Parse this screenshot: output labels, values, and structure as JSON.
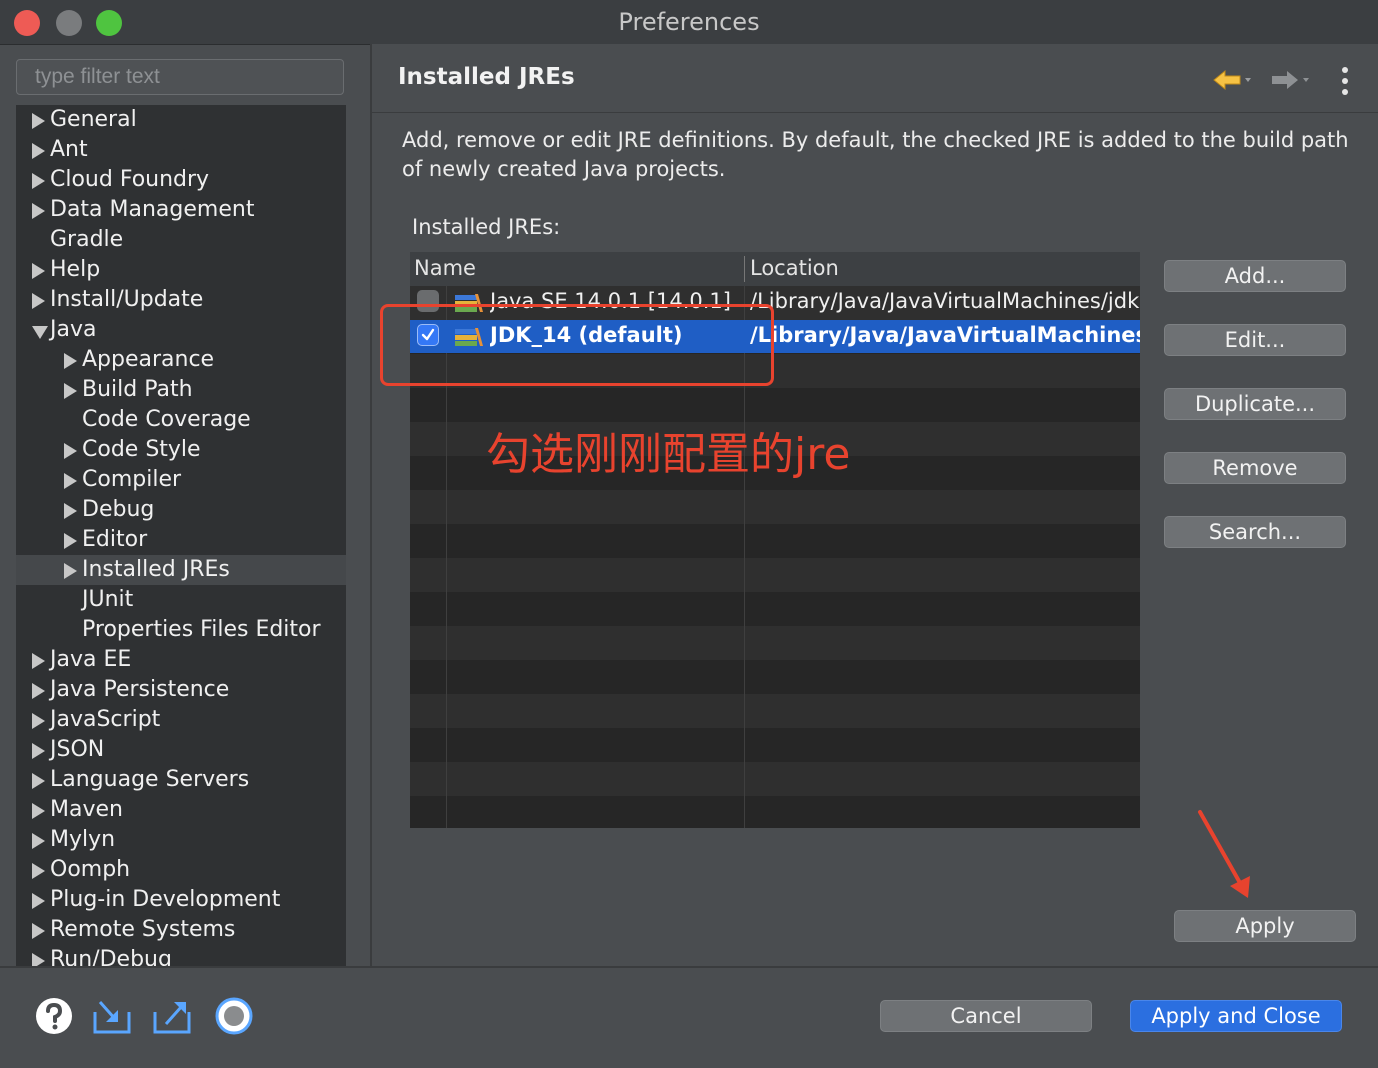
{
  "window": {
    "title": "Preferences"
  },
  "sidebar": {
    "filter_placeholder": "type filter text",
    "items": [
      {
        "label": "General",
        "expanded": false
      },
      {
        "label": "Ant",
        "expanded": false
      },
      {
        "label": "Cloud Foundry",
        "expanded": false
      },
      {
        "label": "Data Management",
        "expanded": false
      },
      {
        "label": "Gradle",
        "expanded": null
      },
      {
        "label": "Help",
        "expanded": false
      },
      {
        "label": "Install/Update",
        "expanded": false
      },
      {
        "label": "Java",
        "expanded": true
      },
      {
        "label": "Appearance",
        "expanded": false,
        "child": true
      },
      {
        "label": "Build Path",
        "expanded": false,
        "child": true
      },
      {
        "label": "Code Coverage",
        "expanded": null,
        "child": true
      },
      {
        "label": "Code Style",
        "expanded": false,
        "child": true
      },
      {
        "label": "Compiler",
        "expanded": false,
        "child": true
      },
      {
        "label": "Debug",
        "expanded": false,
        "child": true
      },
      {
        "label": "Editor",
        "expanded": false,
        "child": true
      },
      {
        "label": "Installed JREs",
        "expanded": false,
        "child": true,
        "selected": true
      },
      {
        "label": "JUnit",
        "expanded": null,
        "child": true
      },
      {
        "label": "Properties Files Editor",
        "expanded": null,
        "child": true
      },
      {
        "label": "Java EE",
        "expanded": false
      },
      {
        "label": "Java Persistence",
        "expanded": false
      },
      {
        "label": "JavaScript",
        "expanded": false
      },
      {
        "label": "JSON",
        "expanded": false
      },
      {
        "label": "Language Servers",
        "expanded": false
      },
      {
        "label": "Maven",
        "expanded": false
      },
      {
        "label": "Mylyn",
        "expanded": false
      },
      {
        "label": "Oomph",
        "expanded": false
      },
      {
        "label": "Plug-in Development",
        "expanded": false
      },
      {
        "label": "Remote Systems",
        "expanded": false
      },
      {
        "label": "Run/Debug",
        "expanded": false
      }
    ]
  },
  "panel": {
    "title": "Installed JREs",
    "description": "Add, remove or edit JRE definitions. By default, the checked JRE is added to the build path of newly created Java projects.",
    "table_label": "Installed JREs:",
    "columns": [
      "Name",
      "Location"
    ],
    "rows": [
      {
        "name": "Java SE 14.0.1 [14.0.1]",
        "location": "/Library/Java/JavaVirtualMachines/jdk",
        "checked": false,
        "selected": false
      },
      {
        "name": "JDK_14 (default)",
        "location": "/Library/Java/JavaVirtualMachines/",
        "checked": true,
        "selected": true
      }
    ],
    "buttons": {
      "add": "Add...",
      "edit": "Edit...",
      "duplicate": "Duplicate...",
      "remove": "Remove",
      "search": "Search...",
      "apply": "Apply"
    }
  },
  "annotation": {
    "text": "勾选刚刚配置的jre",
    "color": "#e8432e"
  },
  "footer": {
    "cancel": "Cancel",
    "apply_close": "Apply and Close"
  },
  "colors": {
    "accent": "#2b6fe0",
    "selection": "#1f5ec5"
  }
}
